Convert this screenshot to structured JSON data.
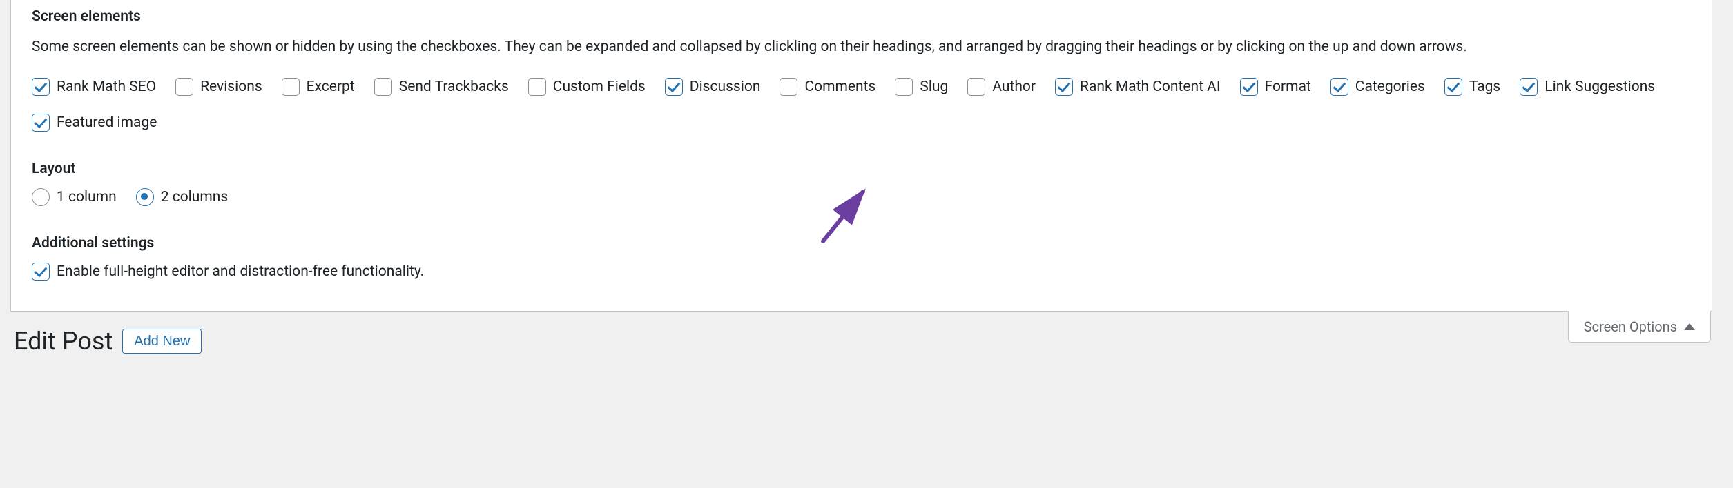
{
  "screen_options": {
    "toggle_label": "Screen Options",
    "elements_heading": "Screen elements",
    "elements_description": "Some screen elements can be shown or hidden by using the checkboxes. They can be expanded and collapsed by clickling on their headings, and arranged by dragging their headings or by clicking on the up and down arrows.",
    "checkboxes": [
      {
        "name": "rank-math-seo",
        "label": "Rank Math SEO",
        "checked": true
      },
      {
        "name": "revisions",
        "label": "Revisions",
        "checked": false
      },
      {
        "name": "excerpt",
        "label": "Excerpt",
        "checked": false
      },
      {
        "name": "send-trackbacks",
        "label": "Send Trackbacks",
        "checked": false
      },
      {
        "name": "custom-fields",
        "label": "Custom Fields",
        "checked": false
      },
      {
        "name": "discussion",
        "label": "Discussion",
        "checked": true
      },
      {
        "name": "comments",
        "label": "Comments",
        "checked": false
      },
      {
        "name": "slug",
        "label": "Slug",
        "checked": false
      },
      {
        "name": "author",
        "label": "Author",
        "checked": false
      },
      {
        "name": "rank-math-content-ai",
        "label": "Rank Math Content AI",
        "checked": true
      },
      {
        "name": "format",
        "label": "Format",
        "checked": true
      },
      {
        "name": "categories",
        "label": "Categories",
        "checked": true
      },
      {
        "name": "tags",
        "label": "Tags",
        "checked": true
      },
      {
        "name": "link-suggestions",
        "label": "Link Suggestions",
        "checked": true
      },
      {
        "name": "featured-image",
        "label": "Featured image",
        "checked": true
      }
    ],
    "layout_heading": "Layout",
    "layout_options": [
      {
        "value": "1",
        "label": "1 column",
        "checked": false
      },
      {
        "value": "2",
        "label": "2 columns",
        "checked": true
      }
    ],
    "additional_heading": "Additional settings",
    "additional": [
      {
        "name": "full-height-editor",
        "label": "Enable full-height editor and distraction-free functionality.",
        "checked": true
      }
    ]
  },
  "page": {
    "title": "Edit Post",
    "add_new_label": "Add New"
  },
  "annotation": {
    "arrow_color": "#6b3fa0",
    "points_to": "discussion-checkbox"
  }
}
